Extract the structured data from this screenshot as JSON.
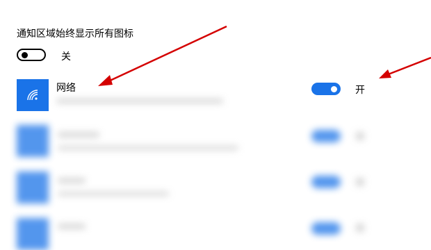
{
  "always_show": {
    "label": "通知区域始终显示所有图标",
    "toggle_state_text": "关"
  },
  "apps": [
    {
      "name": "网络",
      "subtitle": "",
      "state_text": "开",
      "icon": "wifi-icon"
    }
  ],
  "colors": {
    "accent": "#1a73e8",
    "arrow": "#d40000"
  }
}
